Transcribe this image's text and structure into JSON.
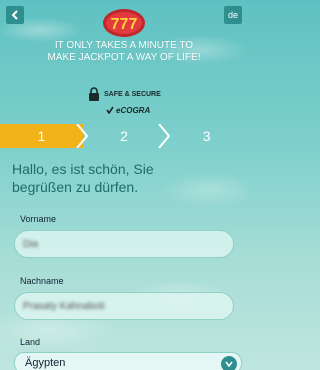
{
  "header": {
    "language": "de",
    "tagline_line1": "IT ONLY TAKES A MINUTE TO",
    "tagline_line2": "MAKE JACKPOT A WAY OF LIFE!",
    "logo_text": "777",
    "safe_secure": "SAFE & SECURE",
    "ecogra": "eCOGRA"
  },
  "steps": [
    "1",
    "2",
    "3"
  ],
  "active_step": 1,
  "greeting_line1": "Hallo, es ist schön, Sie",
  "greeting_line2": "begrüßen zu dürfen.",
  "form": {
    "first_name_label": "Vorname",
    "first_name_value": "Dia",
    "last_name_label": "Nachname",
    "last_name_value": "Prasaty Kahnaboti",
    "country_label": "Land",
    "country_value": "Ägypten"
  },
  "colors": {
    "accent": "#f2b21a",
    "teal": "#2f8f8f",
    "text_heading": "#1f6b6b"
  }
}
